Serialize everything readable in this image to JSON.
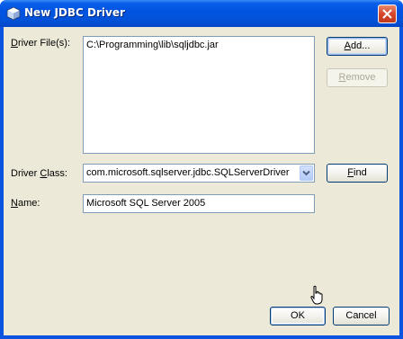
{
  "window": {
    "title": "New JDBC Driver",
    "title_icon": "cube-icon",
    "close_icon": "close-icon"
  },
  "driver_files": {
    "label": "Driver File(s):",
    "mnemonic": "D",
    "label_rest": "river File(s):",
    "items": [
      "C:\\Programming\\lib\\sqljdbc.jar"
    ],
    "add_button": {
      "mnemonic": "A",
      "rest": "dd..."
    },
    "remove_button": {
      "mnemonic": "R",
      "rest": "emove",
      "enabled": false
    }
  },
  "driver_class": {
    "label_pre": "Driver ",
    "mnemonic": "C",
    "label_rest": "lass:",
    "value": "com.microsoft.sqlserver.jdbc.SQLServerDriver",
    "find_button": {
      "mnemonic": "F",
      "rest": "ind"
    }
  },
  "name": {
    "mnemonic": "N",
    "label_rest": "ame:",
    "value": "Microsoft SQL Server 2005"
  },
  "footer": {
    "ok_label": "OK",
    "cancel_label": "Cancel"
  },
  "colors": {
    "titlebar": "#0054e3",
    "client": "#ece9d8",
    "field_border": "#7f9db9"
  }
}
